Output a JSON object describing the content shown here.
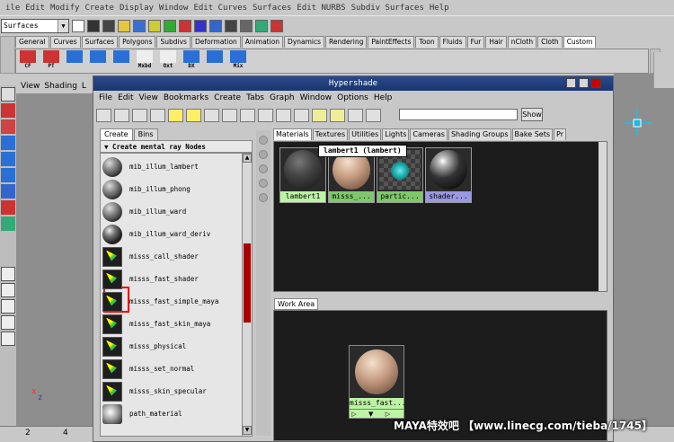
{
  "main_menu": [
    "ile",
    "Edit",
    "Modify",
    "Create",
    "Display",
    "Window",
    "Edit Curves",
    "Surfaces",
    "Edit NURBS",
    "Subdiv Surfaces",
    "Help"
  ],
  "status_line": {
    "mode": "Surfaces"
  },
  "shelf": {
    "tabs": [
      "General",
      "Curves",
      "Surfaces",
      "Polygons",
      "Subdivs",
      "Deformation",
      "Animation",
      "Dynamics",
      "Rendering",
      "PaintEffects",
      "Toon",
      "Fluids",
      "Fur",
      "Hair",
      "nCloth",
      "Cloth",
      "Custom"
    ],
    "active_tab": "Custom",
    "buttons": [
      "CF",
      "PT",
      "",
      "",
      "",
      "Mxbd",
      "Oxt",
      "DX",
      "",
      "Mix"
    ]
  },
  "viewport_menu": [
    "View",
    "Shading",
    "L"
  ],
  "timeline": {
    "ticks": [
      "2",
      "4"
    ]
  },
  "hypershade": {
    "title": "Hypershade",
    "menu": [
      "File",
      "Edit",
      "View",
      "Bookmarks",
      "Create",
      "Tabs",
      "Graph",
      "Window",
      "Options",
      "Help"
    ],
    "show_label": "Show",
    "create_bar": {
      "tabs": [
        "Create",
        "Bins"
      ],
      "header": "Create mental ray Nodes",
      "items": [
        {
          "label": "mib_illum_lambert",
          "icon": "sphere"
        },
        {
          "label": "mib_illum_phong",
          "icon": "sphere"
        },
        {
          "label": "mib_illum_ward",
          "icon": "sphere"
        },
        {
          "label": "mib_illum_ward_deriv",
          "icon": "sphere-red"
        },
        {
          "label": "misss_call_shader",
          "icon": "shader"
        },
        {
          "label": "misss_fast_shader",
          "icon": "shader"
        },
        {
          "label": "misss_fast_simple_maya",
          "icon": "shader"
        },
        {
          "label": "misss_fast_skin_maya",
          "icon": "shader"
        },
        {
          "label": "misss_physical",
          "icon": "shader"
        },
        {
          "label": "misss_set_normal",
          "icon": "shader"
        },
        {
          "label": "misss_skin_specular",
          "icon": "shader"
        },
        {
          "label": "path_material",
          "icon": "path"
        }
      ]
    },
    "shader_tabs": [
      "Materials",
      "Textures",
      "Utilities",
      "Lights",
      "Cameras",
      "Shading Groups",
      "Bake Sets",
      "Pr"
    ],
    "active_shader_tab": "Materials",
    "swatches": [
      {
        "label": "lambert1",
        "cap_color": "#bdf3a5"
      },
      {
        "label": "misss_...",
        "cap_color": "#7ec86a"
      },
      {
        "label": "partic...",
        "cap_color": "#7ec86a"
      },
      {
        "label": "shader...",
        "cap_color": "#9a98e0"
      }
    ],
    "tooltip": "lambert1 (lambert)",
    "work_area": {
      "tab": "Work Area",
      "node": {
        "label": "misss_fast..."
      }
    }
  },
  "watermark": "MAYA特效吧 【www.linecg.com/tieba/1745】",
  "axis_labels": {
    "x": "x",
    "z": "z"
  }
}
